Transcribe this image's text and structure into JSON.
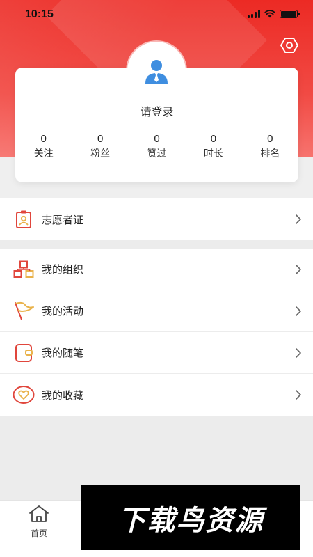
{
  "status_bar": {
    "time": "10:15"
  },
  "profile": {
    "login_prompt": "请登录",
    "stats": [
      {
        "value": "0",
        "label": "关注"
      },
      {
        "value": "0",
        "label": "粉丝"
      },
      {
        "value": "0",
        "label": "赞过"
      },
      {
        "value": "0",
        "label": "时长"
      },
      {
        "value": "0",
        "label": "排名"
      }
    ]
  },
  "menu": {
    "volunteer_card": "志愿者证",
    "my_organization": "我的组织",
    "my_activities": "我的活动",
    "my_notes": "我的随笔",
    "my_favorites": "我的收藏"
  },
  "tab_bar": {
    "home": "首页"
  },
  "watermark": {
    "text": "下载鸟资源"
  },
  "colors": {
    "brand_red": "#ec2a24",
    "icon_red": "#e0463c",
    "icon_gold": "#e9b24a"
  }
}
